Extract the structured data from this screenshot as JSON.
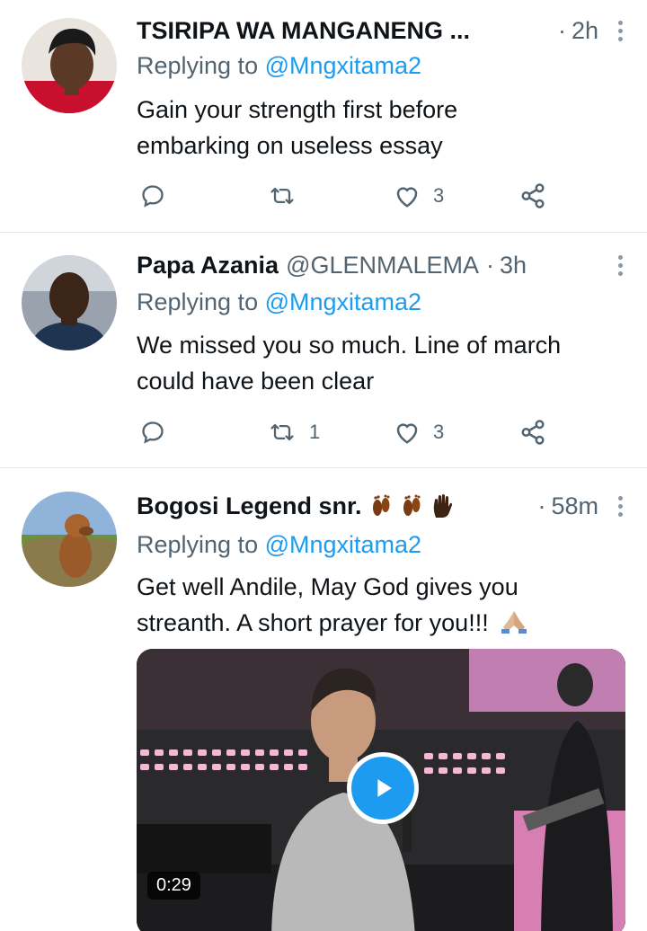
{
  "tweets": [
    {
      "name": "TSIRIPA WA MANGANENG ...",
      "handle": "",
      "separator": "·",
      "time": "2h",
      "replying_prefix": "Replying to ",
      "replying_to": "@Mngxitama2",
      "text": "Gain your strength first before embarking on useless essay",
      "actions": {
        "reply_count": "",
        "retweet_count": "",
        "like_count": "3"
      }
    },
    {
      "name": "Papa Azania",
      "handle": "@GLENMALEMA",
      "separator": "·",
      "time": "3h",
      "replying_prefix": "Replying to ",
      "replying_to": "@Mngxitama2",
      "text": "We missed you so much. Line of march could have been clear",
      "actions": {
        "reply_count": "",
        "retweet_count": "1",
        "like_count": "3"
      }
    },
    {
      "name": "Bogosi Legend snr.",
      "handle": "",
      "separator": "·",
      "time": "58m",
      "replying_prefix": "Replying to ",
      "replying_to": "@Mngxitama2",
      "text": "Get well Andile, May God gives you streanth. A short prayer for you!!!",
      "media": {
        "duration": "0:29"
      }
    }
  ],
  "icons": {
    "reply": "reply-icon",
    "retweet": "retweet-icon",
    "like": "heart-icon",
    "share": "share-icon",
    "more": "more-vertical-icon",
    "play": "play-icon",
    "footprints": "footprints-emoji",
    "hand": "raised-hand-emoji",
    "pray": "folded-hands-emoji"
  },
  "colors": {
    "link": "#1d9bf0",
    "secondary_text": "#536471",
    "primary_text": "#0f1419",
    "divider": "#e1e8ed"
  }
}
